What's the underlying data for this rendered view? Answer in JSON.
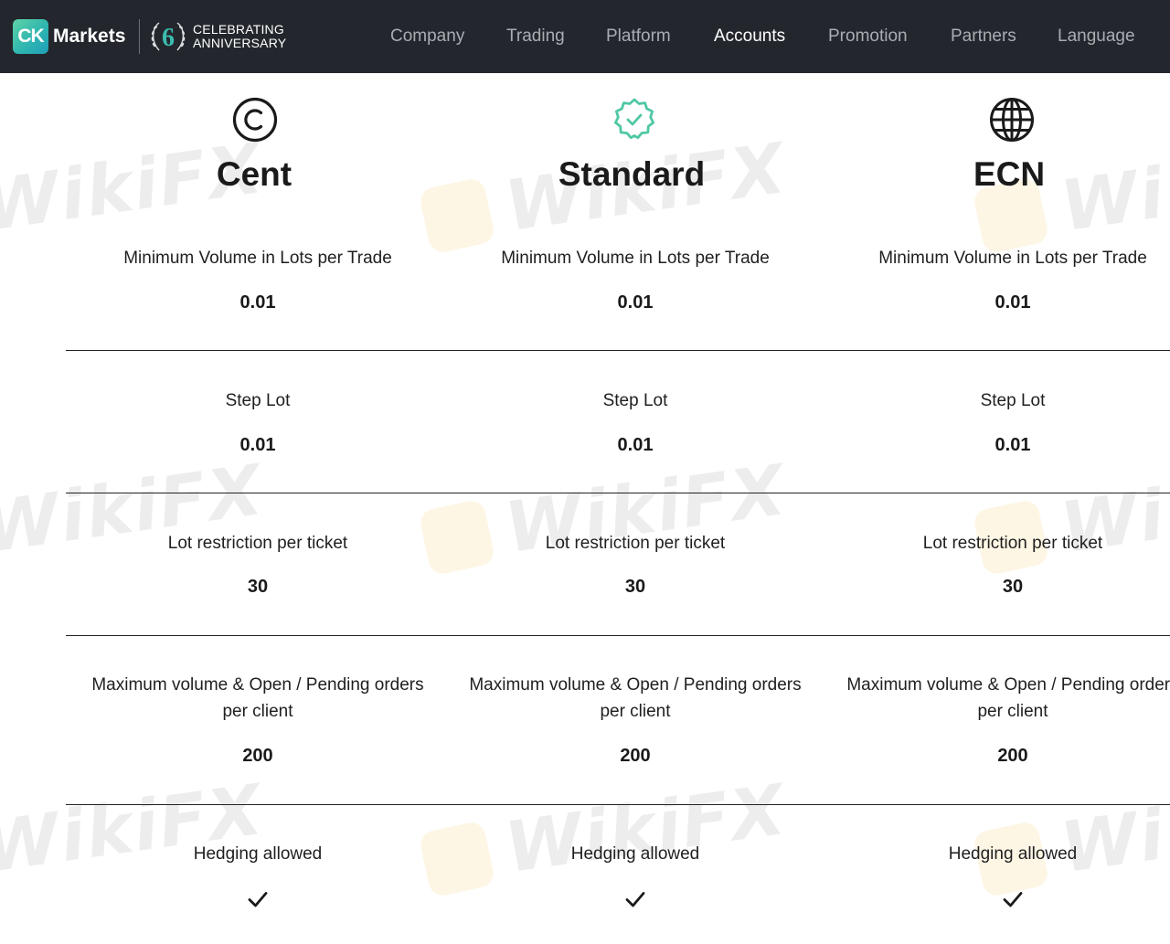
{
  "header": {
    "logo_mark": "CK",
    "logo_text": "Markets",
    "anniversary_number": "6",
    "anniversary_line1": "CELEBRATING",
    "anniversary_line2": "ANNIVERSARY",
    "nav": [
      {
        "label": "Company",
        "active": false
      },
      {
        "label": "Trading",
        "active": false
      },
      {
        "label": "Platform",
        "active": false
      },
      {
        "label": "Accounts",
        "active": true
      },
      {
        "label": "Promotion",
        "active": false
      },
      {
        "label": "Partners",
        "active": false
      },
      {
        "label": "Language",
        "active": false
      }
    ]
  },
  "watermark_text": "WikiFX",
  "accounts": [
    {
      "name": "Cent",
      "icon": "copyright-circle-icon",
      "min_volume_label": "Minimum Volume in Lots per Trade",
      "min_volume_value": "0.01",
      "step_lot_label": "Step Lot",
      "step_lot_value": "0.01",
      "lot_restriction_label": "Lot restriction per ticket",
      "lot_restriction_value": "30",
      "max_volume_label_line1": "Maximum volume & Open / Pending orders",
      "max_volume_label_line2": "per client",
      "max_volume_value": "200",
      "hedging_label": "Hedging allowed",
      "hedging_allowed": true
    },
    {
      "name": "Standard",
      "icon": "verified-badge-icon",
      "min_volume_label": "Minimum Volume in Lots per Trade",
      "min_volume_value": "0.01",
      "step_lot_label": "Step Lot",
      "step_lot_value": "0.01",
      "lot_restriction_label": "Lot restriction per ticket",
      "lot_restriction_value": "30",
      "max_volume_label_line1": "Maximum volume & Open / Pending orders",
      "max_volume_label_line2": "per client",
      "max_volume_value": "200",
      "hedging_label": "Hedging allowed",
      "hedging_allowed": true
    },
    {
      "name": "ECN",
      "icon": "globe-icon",
      "min_volume_label": "Minimum Volume in Lots per Trade",
      "min_volume_value": "0.01",
      "step_lot_label": "Step Lot",
      "step_lot_value": "0.01",
      "lot_restriction_label": "Lot restriction per ticket",
      "lot_restriction_value": "30",
      "max_volume_label_line1": "Maximum volume & Open / Pending orders",
      "max_volume_label_line2": "per client",
      "max_volume_value": "200",
      "hedging_label": "Hedging allowed",
      "hedging_allowed": true
    }
  ],
  "colors": {
    "header_bg": "#23272d",
    "nav_inactive": "#a9adb3",
    "nav_active": "#ffffff",
    "brand_gradient_start": "#5fd3a6",
    "brand_gradient_end": "#1f9fb9",
    "standard_icon": "#4fc7a4",
    "text": "#1a1a1a"
  }
}
